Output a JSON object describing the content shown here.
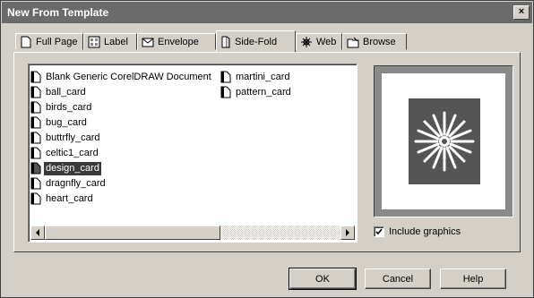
{
  "window": {
    "title": "New From Template",
    "close_label": "×"
  },
  "tabs": [
    {
      "label": "Full Page",
      "icon": "page-icon"
    },
    {
      "label": "Label",
      "icon": "label-icon"
    },
    {
      "label": "Envelope",
      "icon": "envelope-icon"
    },
    {
      "label": "Side-Fold",
      "icon": "side-fold-icon",
      "active": true
    },
    {
      "label": "Web",
      "icon": "web-icon"
    },
    {
      "label": "Browse",
      "icon": "browse-icon"
    }
  ],
  "templates": [
    {
      "label": "Blank Generic CorelDRAW Document"
    },
    {
      "label": "ball_card"
    },
    {
      "label": "birds_card"
    },
    {
      "label": "bug_card"
    },
    {
      "label": "buttrfly_card"
    },
    {
      "label": "celtic1_card"
    },
    {
      "label": "design_card",
      "selected": true
    },
    {
      "label": "dragnfly_card"
    },
    {
      "label": "heart_card"
    },
    {
      "label": "martini_card"
    },
    {
      "label": "pattern_card"
    }
  ],
  "include_graphics": {
    "label": "Include graphics",
    "checked": true
  },
  "buttons": {
    "ok": "OK",
    "cancel": "Cancel",
    "help": "Help"
  }
}
